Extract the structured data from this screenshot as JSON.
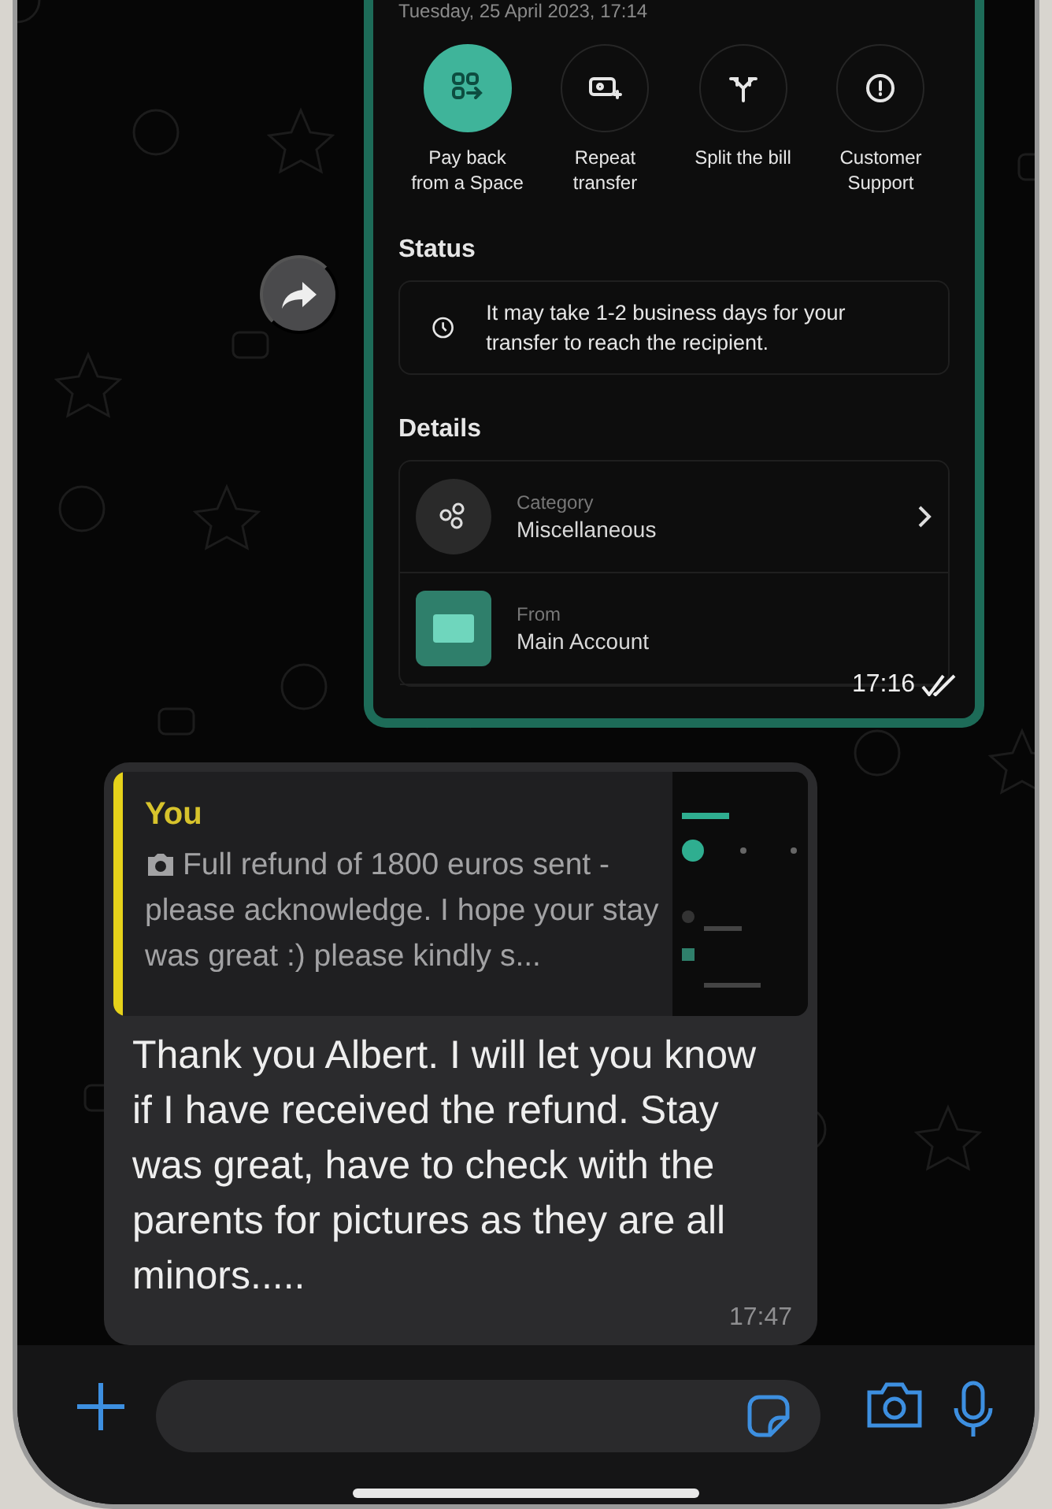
{
  "shared_screenshot": {
    "date": "Tuesday, 25 April 2023, 17:14",
    "actions": [
      {
        "label": "Pay back\nfrom a Space",
        "highlighted": true
      },
      {
        "label": "Repeat\ntransfer",
        "highlighted": false
      },
      {
        "label": "Split the bill",
        "highlighted": false
      },
      {
        "label": "Customer\nSupport",
        "highlighted": false
      }
    ],
    "status_heading": "Status",
    "status_text": "It may take 1-2 business days for your transfer to reach the recipient.",
    "details_heading": "Details",
    "details": [
      {
        "kind": "category",
        "label": "Category",
        "value": "Miscellaneous"
      },
      {
        "kind": "account",
        "label": "From",
        "value": "Main Account"
      }
    ]
  },
  "image_message_time": "17:16",
  "image_message_read": true,
  "reply": {
    "quote": {
      "author": "You",
      "text": "Full refund of 1800 euros sent - please acknowledge. I hope your stay was great :) please kindly s..."
    },
    "text": "Thank you Albert. I will let you know if I have received the refund. Stay was great, have to check with the parents for pictures as they are all minors.....",
    "time": "17:47"
  }
}
